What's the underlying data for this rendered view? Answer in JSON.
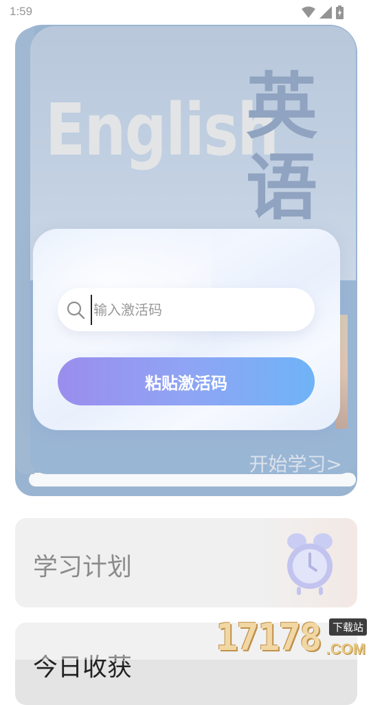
{
  "status_bar": {
    "time": "1:59",
    "icons": [
      "wifi-icon",
      "signal-icon",
      "battery-charging-icon"
    ]
  },
  "book": {
    "english_title": "English",
    "chinese_title": "英语",
    "start_link": "开始学习>"
  },
  "cards": {
    "plan_label": "学习计划",
    "favorites_label": "今日收获"
  },
  "modal": {
    "input_placeholder": "输入激活码",
    "input_value": "",
    "paste_button_label": "粘贴激活码"
  },
  "watermark": {
    "digits": "17178",
    "site": "下载站",
    "com": ".COM"
  },
  "colors": {
    "accent": "#8f9ff2",
    "book_blue": "#3d6fa8",
    "title_blue": "#2b4f86"
  }
}
